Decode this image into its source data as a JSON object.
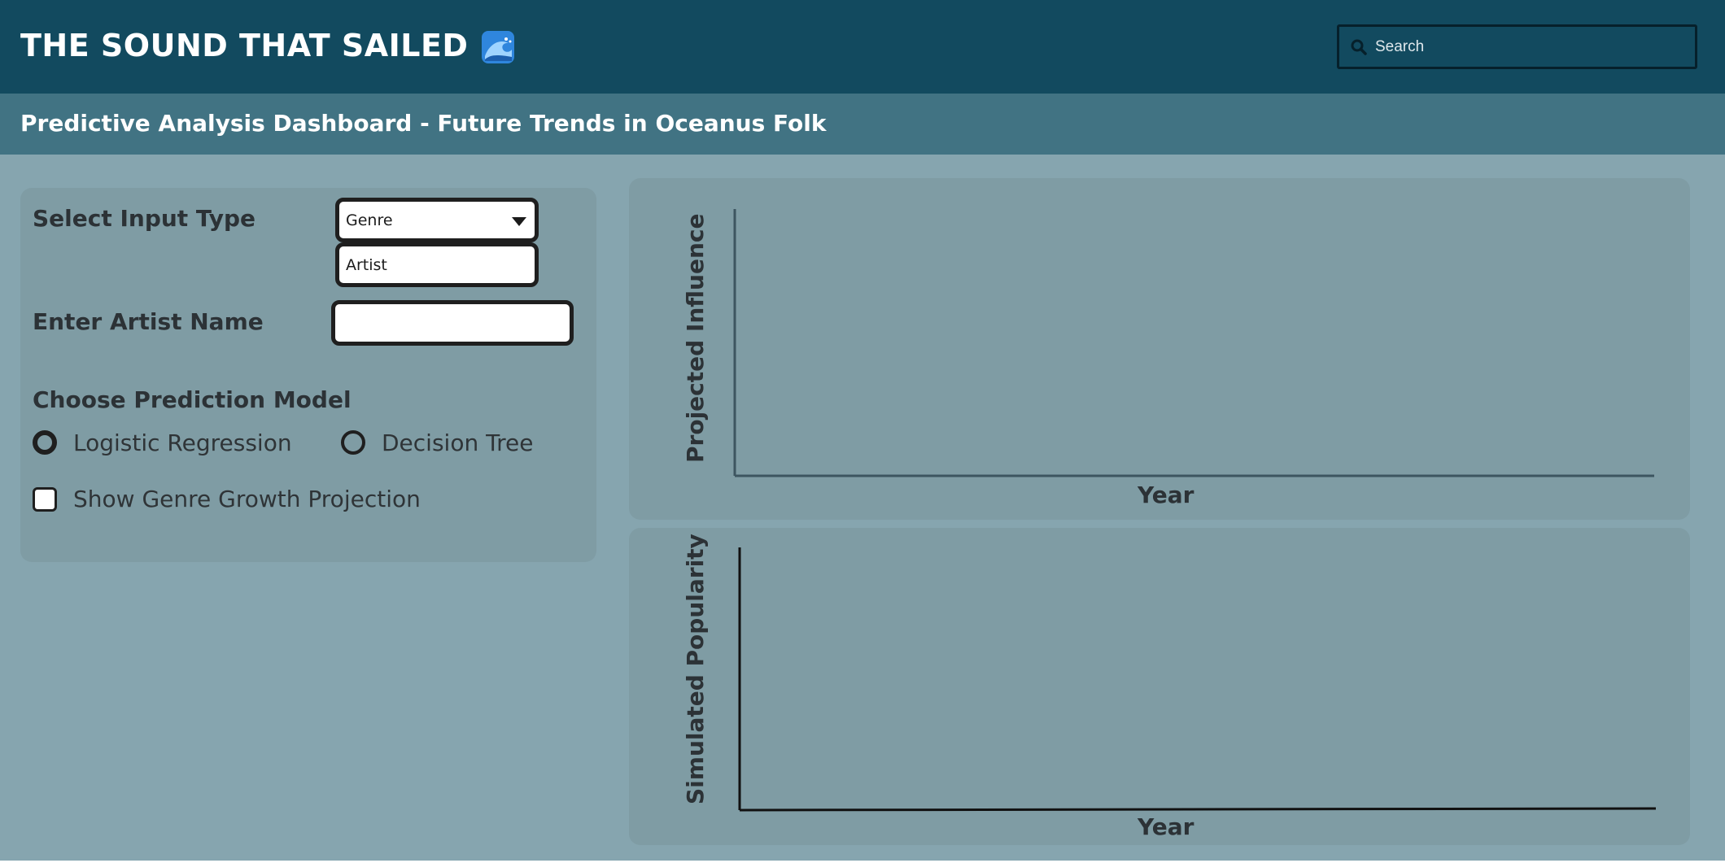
{
  "header": {
    "title": "THE SOUND THAT SAILED",
    "title_icon": "water-wave-icon",
    "search": {
      "placeholder": "Search",
      "value": ""
    }
  },
  "subheader": {
    "title": "Predictive Analysis Dashboard - Future Trends in Oceanus Folk"
  },
  "controls": {
    "input_type_label": "Select Input Type",
    "input_type_selected": "Genre",
    "input_type_options": [
      "Artist"
    ],
    "artist_name_label": "Enter Artist Name",
    "artist_name_value": "",
    "model_label": "Choose Prediction Model",
    "models": [
      {
        "label": "Logistic Regression",
        "selected": true
      },
      {
        "label": "Decision Tree",
        "selected": false
      }
    ],
    "genre_growth": {
      "label": "Show Genre Growth Projection",
      "checked": false
    }
  },
  "charts": {
    "influence": {
      "ylabel": "Projected Influence",
      "xlabel": "Year"
    },
    "popularity": {
      "ylabel": "Simulated Popularity",
      "xlabel": "Year"
    }
  },
  "colors": {
    "header_bg": "#124a5f",
    "subheader_bg": "#417383",
    "page_bg": "#86a5af",
    "card_bg": "#7f9ca4"
  },
  "chart_data": [
    {
      "type": "line",
      "series": [],
      "xlabel": "Year",
      "ylabel": "Projected Influence"
    },
    {
      "type": "line",
      "series": [],
      "xlabel": "Year",
      "ylabel": "Simulated Popularity"
    }
  ]
}
